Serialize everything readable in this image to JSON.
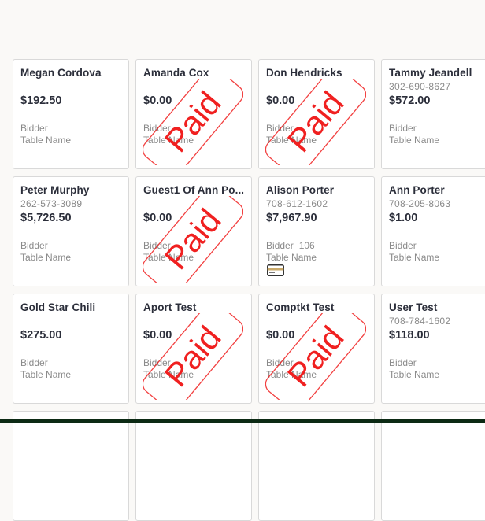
{
  "cards": [
    {
      "name": "Megan Cordova",
      "phone": "",
      "amount": "$192.50",
      "bidder_label": "Bidder",
      "bidder_number": "",
      "table_label": "Table Name",
      "paid": false,
      "paid_label": "",
      "card_icon": false
    },
    {
      "name": "Amanda Cox",
      "phone": "",
      "amount": "$0.00",
      "bidder_label": "Bidder",
      "bidder_number": "",
      "table_label": "Table Name",
      "paid": true,
      "paid_label": "Paid",
      "card_icon": false
    },
    {
      "name": "Don Hendricks",
      "phone": "",
      "amount": "$0.00",
      "bidder_label": "Bidder",
      "bidder_number": "",
      "table_label": "Table Name",
      "paid": true,
      "paid_label": "Paid",
      "card_icon": false
    },
    {
      "name": "Tammy Jeandell",
      "phone": "302-690-8627",
      "amount": "$572.00",
      "bidder_label": "Bidder",
      "bidder_number": "",
      "table_label": "Table Name",
      "paid": false,
      "paid_label": "",
      "card_icon": false
    },
    {
      "name": "Peter Murphy",
      "phone": "262-573-3089",
      "amount": "$5,726.50",
      "bidder_label": "Bidder",
      "bidder_number": "",
      "table_label": "Table Name",
      "paid": false,
      "paid_label": "",
      "card_icon": false
    },
    {
      "name": "Guest1 Of Ann Po...",
      "phone": "",
      "amount": "$0.00",
      "bidder_label": "Bidder",
      "bidder_number": "",
      "table_label": "Table Name",
      "paid": true,
      "paid_label": "Paid",
      "card_icon": false
    },
    {
      "name": "Alison Porter",
      "phone": "708-612-1602",
      "amount": "$7,967.90",
      "bidder_label": "Bidder",
      "bidder_number": "106",
      "table_label": "Table Name",
      "paid": false,
      "paid_label": "",
      "card_icon": true
    },
    {
      "name": "Ann Porter",
      "phone": "708-205-8063",
      "amount": "$1.00",
      "bidder_label": "Bidder",
      "bidder_number": "",
      "table_label": "Table Name",
      "paid": false,
      "paid_label": "",
      "card_icon": false
    },
    {
      "name": "Gold Star Chili",
      "phone": "",
      "amount": "$275.00",
      "bidder_label": "Bidder",
      "bidder_number": "",
      "table_label": "Table Name",
      "paid": false,
      "paid_label": "",
      "card_icon": false
    },
    {
      "name": "Aport Test",
      "phone": "",
      "amount": "$0.00",
      "bidder_label": "Bidder",
      "bidder_number": "",
      "table_label": "Table Name",
      "paid": true,
      "paid_label": "Paid",
      "card_icon": false
    },
    {
      "name": "Comptkt Test",
      "phone": "",
      "amount": "$0.00",
      "bidder_label": "Bidder",
      "bidder_number": "",
      "table_label": "Table Name",
      "paid": true,
      "paid_label": "Paid",
      "card_icon": false
    },
    {
      "name": "User Test",
      "phone": "708-784-1602",
      "amount": "$118.00",
      "bidder_label": "Bidder",
      "bidder_number": "",
      "table_label": "Table Name",
      "paid": false,
      "paid_label": "",
      "card_icon": false
    },
    {
      "name": "",
      "phone": "",
      "amount": "",
      "bidder_label": "",
      "bidder_number": "",
      "table_label": "",
      "paid": false,
      "paid_label": "",
      "card_icon": false
    },
    {
      "name": "",
      "phone": "",
      "amount": "",
      "bidder_label": "",
      "bidder_number": "",
      "table_label": "",
      "paid": false,
      "paid_label": "",
      "card_icon": false
    },
    {
      "name": "",
      "phone": "",
      "amount": "",
      "bidder_label": "",
      "bidder_number": "",
      "table_label": "",
      "paid": false,
      "paid_label": "",
      "card_icon": false
    },
    {
      "name": "",
      "phone": "",
      "amount": "",
      "bidder_label": "",
      "bidder_number": "",
      "table_label": "",
      "paid": false,
      "paid_label": "",
      "card_icon": false
    }
  ],
  "colors": {
    "stamp": "#f02020",
    "text_dark": "#2b2e3a",
    "text_muted": "#8a8a8a",
    "card_border": "#d9d9d9",
    "page_bg": "#faf9f7"
  },
  "icons": {
    "payment_card": "credit-card-icon"
  }
}
